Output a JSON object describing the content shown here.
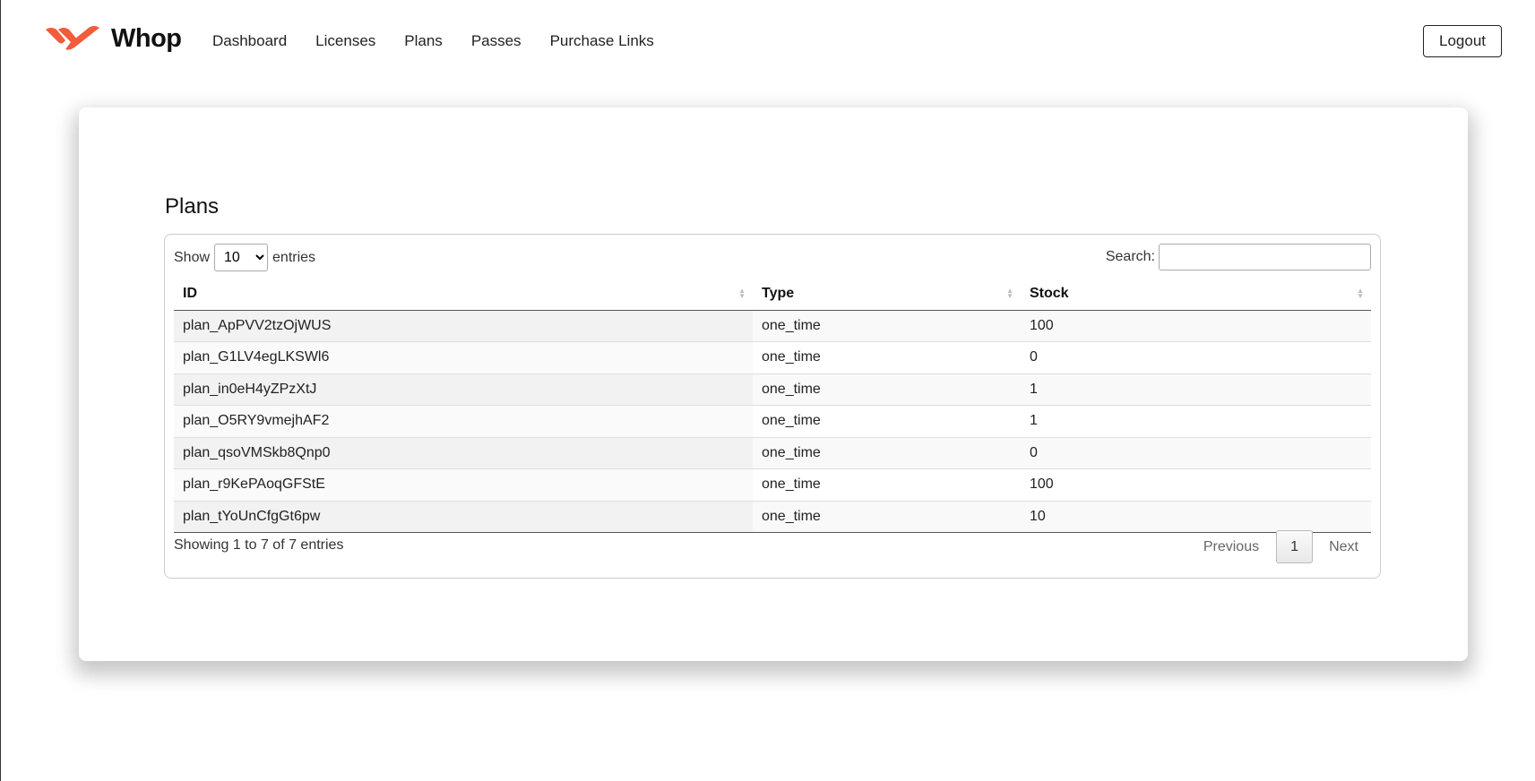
{
  "app": {
    "brand": "Whop",
    "accent_color": "#f25c3a"
  },
  "nav": {
    "items": [
      {
        "label": "Dashboard"
      },
      {
        "label": "Licenses"
      },
      {
        "label": "Plans"
      },
      {
        "label": "Passes"
      },
      {
        "label": "Purchase Links"
      }
    ],
    "logout_label": "Logout"
  },
  "page": {
    "title": "Plans"
  },
  "table": {
    "length": {
      "prefix": "Show",
      "selected": "10",
      "suffix": "entries"
    },
    "search": {
      "label": "Search:",
      "value": ""
    },
    "columns": [
      "ID",
      "Type",
      "Stock"
    ],
    "rows": [
      [
        "plan_ApPVV2tzOjWUS",
        "one_time",
        "100"
      ],
      [
        "plan_G1LV4egLKSWl6",
        "one_time",
        "0"
      ],
      [
        "plan_in0eH4yZPzXtJ",
        "one_time",
        "1"
      ],
      [
        "plan_O5RY9vmejhAF2",
        "one_time",
        "1"
      ],
      [
        "plan_qsoVMSkb8Qnp0",
        "one_time",
        "0"
      ],
      [
        "plan_r9KePAoqGFStE",
        "one_time",
        "100"
      ],
      [
        "plan_tYoUnCfgGt6pw",
        "one_time",
        "10"
      ]
    ],
    "info": "Showing 1 to 7 of 7 entries",
    "pagination": {
      "previous": "Previous",
      "current": "1",
      "next": "Next"
    }
  }
}
